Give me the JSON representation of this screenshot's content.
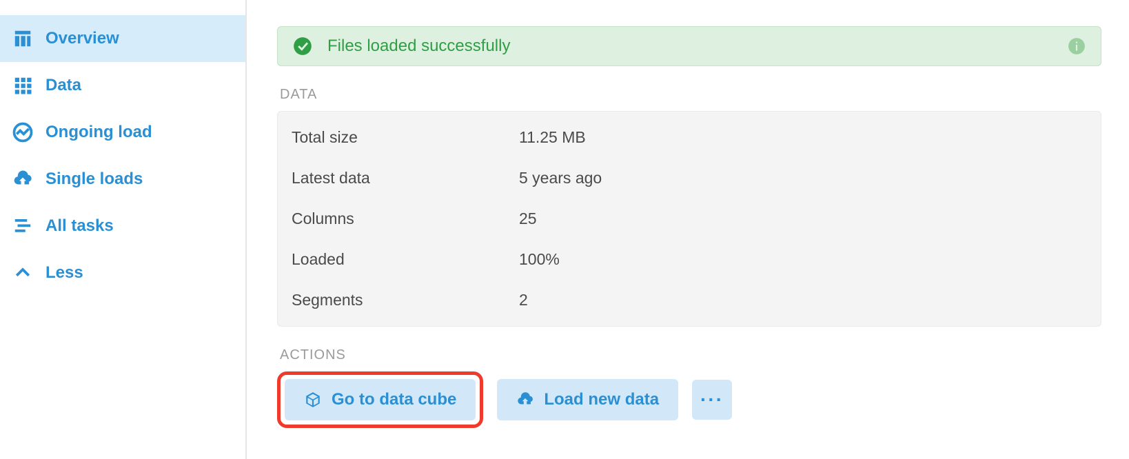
{
  "sidebar": {
    "items": [
      {
        "label": "Overview",
        "icon": "overview-icon",
        "active": true
      },
      {
        "label": "Data",
        "icon": "grid-icon",
        "active": false
      },
      {
        "label": "Ongoing load",
        "icon": "chart-icon",
        "active": false
      },
      {
        "label": "Single loads",
        "icon": "cloud-upload-icon",
        "active": false
      },
      {
        "label": "All tasks",
        "icon": "tasks-icon",
        "active": false
      },
      {
        "label": "Less",
        "icon": "chevron-up-icon",
        "active": false
      }
    ]
  },
  "alert": {
    "message": "Files loaded successfully"
  },
  "sections": {
    "data_title": "DATA",
    "actions_title": "ACTIONS"
  },
  "data_stats": [
    {
      "label": "Total size",
      "value": "11.25 MB"
    },
    {
      "label": "Latest data",
      "value": "5 years ago"
    },
    {
      "label": "Columns",
      "value": "25"
    },
    {
      "label": "Loaded",
      "value": "100%"
    },
    {
      "label": "Segments",
      "value": "2"
    }
  ],
  "actions": {
    "go_to_data_cube": "Go to data cube",
    "load_new_data": "Load new data",
    "more": "···"
  }
}
